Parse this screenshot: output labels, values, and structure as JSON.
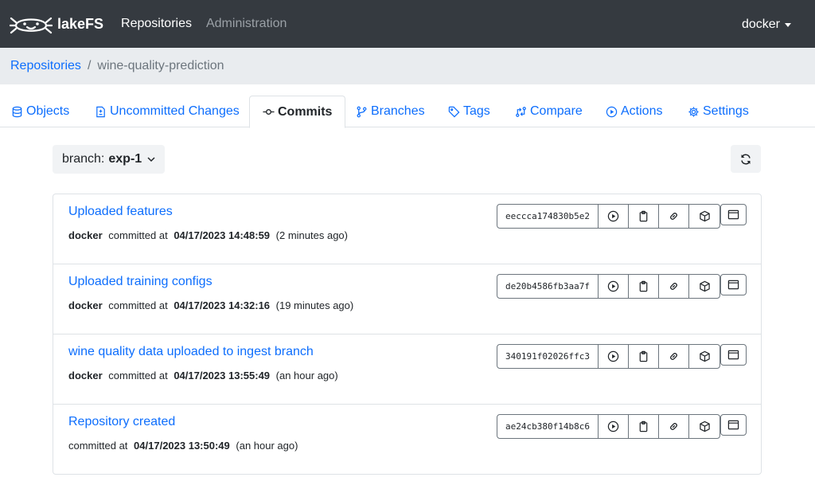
{
  "topnav": {
    "logo_text": "lakeFS",
    "links": [
      {
        "label": "Repositories"
      },
      {
        "label": "Administration"
      }
    ],
    "user": "docker"
  },
  "breadcrumb": {
    "root": "Repositories",
    "separator": "/",
    "current": "wine-quality-prediction"
  },
  "tabs": [
    {
      "label": "Objects",
      "icon": "database-icon"
    },
    {
      "label": "Uncommitted Changes",
      "icon": "file-diff-icon"
    },
    {
      "label": "Commits",
      "icon": "git-commit-icon",
      "active": true
    },
    {
      "label": "Branches",
      "icon": "git-branch-icon"
    },
    {
      "label": "Tags",
      "icon": "tag-icon"
    },
    {
      "label": "Compare",
      "icon": "compare-icon"
    },
    {
      "label": "Actions",
      "icon": "play-icon"
    },
    {
      "label": "Settings",
      "icon": "gear-icon"
    }
  ],
  "branch_selector": {
    "prefix": "branch:",
    "value": "exp-1"
  },
  "commits": [
    {
      "message": "Uploaded features",
      "committer": "docker",
      "committed_at_label": "committed at",
      "timestamp": "04/17/2023 14:48:59",
      "relative": "(2 minutes ago)",
      "id": "eeccca174830b5e2"
    },
    {
      "message": "Uploaded training configs",
      "committer": "docker",
      "committed_at_label": "committed at",
      "timestamp": "04/17/2023 14:32:16",
      "relative": "(19 minutes ago)",
      "id": "de20b4586fb3aa7f"
    },
    {
      "message": "wine quality data uploaded to ingest branch",
      "committer": "docker",
      "committed_at_label": "committed at",
      "timestamp": "04/17/2023 13:55:49",
      "relative": "(an hour ago)",
      "id": "340191f02026ffc3"
    },
    {
      "message": "Repository created",
      "committer": "",
      "committed_at_label": "committed at",
      "timestamp": "04/17/2023 13:50:49",
      "relative": "(an hour ago)",
      "id": "ae24cb380f14b8c6"
    }
  ],
  "colors": {
    "nav_bg": "#353a40",
    "link": "#0d6efd",
    "breadcrumb_bg": "#e9ecef"
  }
}
